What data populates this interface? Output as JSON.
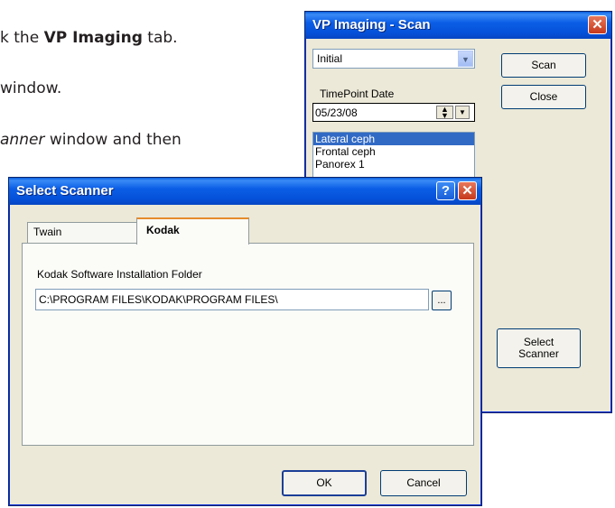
{
  "doc": {
    "line1_prefix": "k the ",
    "line1_bold": "VP Imaging",
    "line1_suffix": " tab.",
    "line2": "window.",
    "line3_italic": "anner",
    "line3_suffix": " window and then"
  },
  "scan_window": {
    "title": "VP Imaging - Scan",
    "close_glyph": "✕",
    "type_select": {
      "value": "Initial"
    },
    "timepoint_label": "TimePoint Date",
    "date_value": "05/23/08",
    "scan_button": "Scan",
    "close_button": "Close",
    "image_list": [
      "Lateral ceph",
      "Frontal ceph",
      "Panorex 1"
    ],
    "select_scanner_line1": "Select",
    "select_scanner_line2": "Scanner"
  },
  "scanner_dialog": {
    "title": "Select Scanner",
    "help_glyph": "?",
    "close_glyph": "✕",
    "tabs": [
      {
        "label": "Twain"
      },
      {
        "label": "Kodak"
      }
    ],
    "folder_label": "Kodak Software Installation Folder",
    "folder_value": "C:\\PROGRAM FILES\\KODAK\\PROGRAM FILES\\",
    "browse_label": "...",
    "ok_button": "OK",
    "cancel_button": "Cancel"
  }
}
